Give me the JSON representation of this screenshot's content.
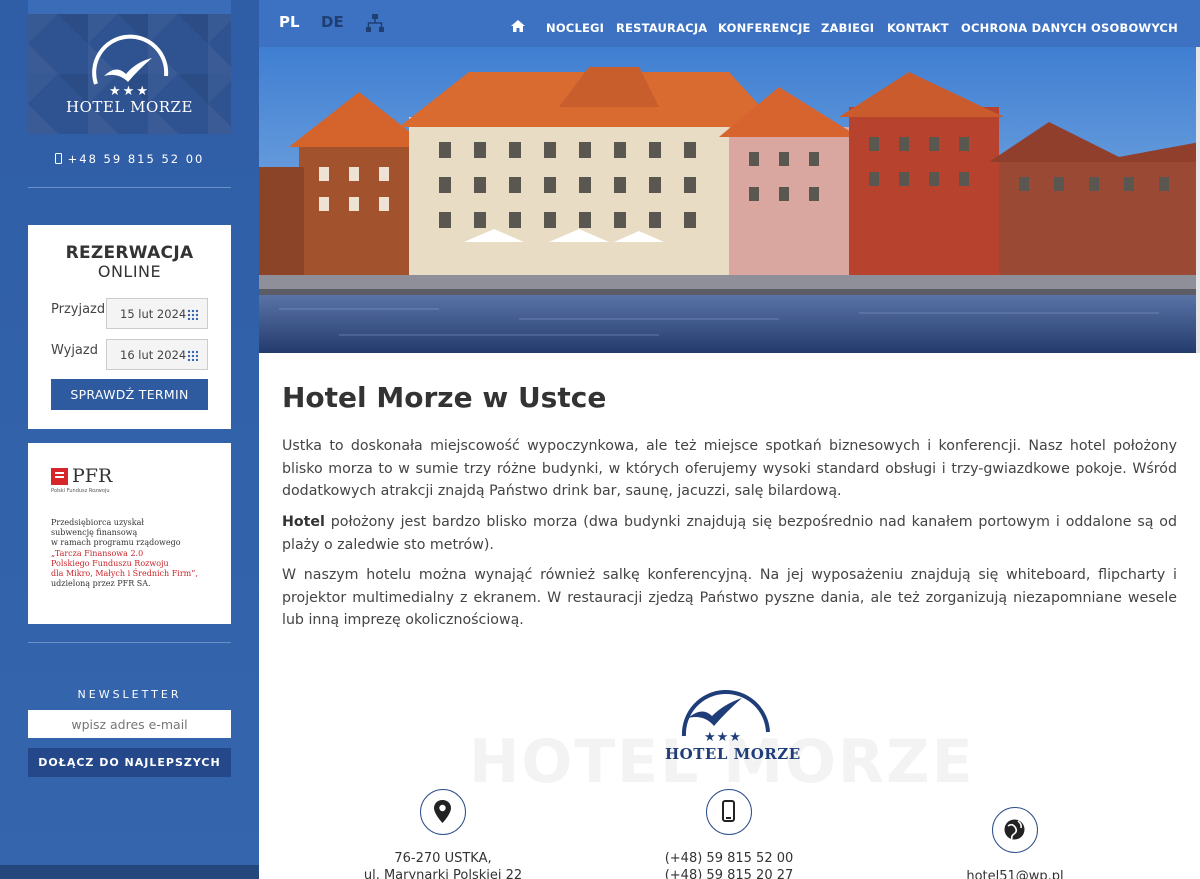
{
  "sidebar": {
    "logo_name": "HOTEL MORZE",
    "logo_stars": "★★★",
    "phone": "+48 59 815 52 00",
    "reservation": {
      "title": "REZERWACJA",
      "subtitle": "ONLINE",
      "arrival_label": "Przyjazd",
      "arrival_value": "15 lut 2024",
      "departure_label": "Wyjazd",
      "departure_value": "16 lut 2024",
      "button": "SPRAWDŹ TERMIN"
    },
    "pfr": {
      "name": "PFR",
      "subname": "Polski Fundusz Rozwoju",
      "line1": "Przedsiębiorca uzyskał",
      "line2": "subwencję finansową",
      "line3": "w ramach programu rządowego",
      "line4": "„Tarcza Finansowa 2.0",
      "line5": "Polskiego Funduszu Rozwoju",
      "line6": "dla Mikro, Małych i Średnich Firm”,",
      "line7": "udzieloną przez PFR SA."
    },
    "newsletter": {
      "title": "NEWSLETTER",
      "placeholder": "wpisz adres e-mail",
      "button": "DOŁĄCZ DO NAJLEPSZYCH"
    }
  },
  "topbar": {
    "lang_pl": "PL",
    "lang_de": "DE",
    "nav": [
      "NOCLEGI",
      "RESTAURACJA",
      "KONFERENCJE",
      "ZABIEGI",
      "KONTAKT",
      "OCHRONA DANYCH OSOBOWYCH"
    ]
  },
  "content": {
    "title": "Hotel Morze w Ustce",
    "para1": "Ustka to doskonała miejscowość wypoczynkowa, ale też miejsce spotkań biznesowych i konferencji. Nasz hotel położony blisko morza to w sumie trzy różne budynki, w których oferujemy wysoki standard obsługi i trzy-gwiazdkowe pokoje. Wśród dodatkowych atrakcji znajdą Państwo drink bar, saunę, jacuzzi, salę bilardową.",
    "para2_bold": "Hotel",
    "para2_rest": " położony jest bardzo blisko morza (dwa budynki znajdują się bezpośrednio nad kanałem portowym i oddalone są od plaży o zaledwie sto metrów).",
    "para3": "W naszym hotelu można wynająć również salkę konferencyjną. Na jej wyposażeniu znajdują się whiteboard, flipcharty i projektor multimedialny z ekranem. W restauracji zjedzą Państwo pyszne dania, ale też zorganizują niezapomniane wesele lub inną imprezę okolicznościową.",
    "watermark": "HOTEL MORZE",
    "footer_logo_stars": "★★★",
    "footer_logo_name": "HOTEL MORZE",
    "address_line1": "76-270 USTKA,",
    "address_line2": "ul. Marynarki Polskiej 22",
    "phone_line1": "(+48) 59 815 52 00",
    "phone_line2": "(+48) 59 815 20 27",
    "email": "hotel51@wp.pl"
  }
}
